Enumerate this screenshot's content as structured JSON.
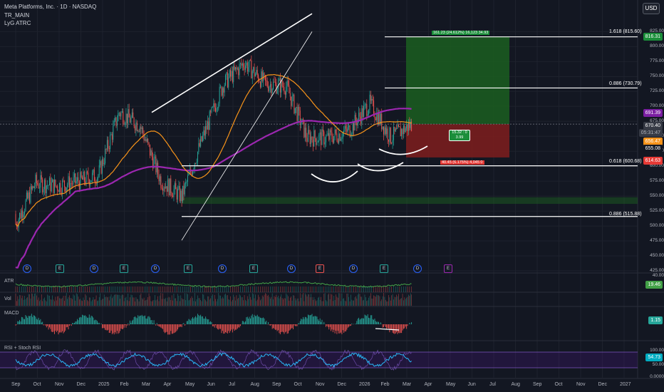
{
  "header": {
    "title": "Meta Platforms, Inc. · 1D · NASDAQ",
    "indicator1": "TR_MAIN",
    "indicator2": "LyG ATRC"
  },
  "currency_button": "USD",
  "price_axis": [
    "825.00",
    "800.00",
    "775.00",
    "750.00",
    "725.00",
    "700.00",
    "675.00",
    "650.00",
    "625.00",
    "600.00",
    "575.00",
    "550.00",
    "525.00",
    "500.00",
    "475.00",
    "450.00",
    "425.00"
  ],
  "price_badges": {
    "target": "816.31",
    "ma_purple": "691.39",
    "last_price": "670.40",
    "countdown": "05:31:47",
    "ma_orange": "656.47",
    "level_655": "655.08",
    "stop": "614.63"
  },
  "fib_labels": {
    "f1618": "1.618 (815.60)",
    "f886a": "0.886 (730.79)",
    "f618": "0.618 (600.68)",
    "f886b": "0.886 (515.88)"
  },
  "position_tool": {
    "target_text": "161.23 (24.612%) 16,123 34.93",
    "center_text1": "15.32 : 0",
    "center_text2": "3.99",
    "stop_text": "40.45 (6.175%) 4,045 0"
  },
  "time_axis": [
    "Sep",
    "Oct",
    "Nov",
    "Dec",
    "2025",
    "Feb",
    "Mar",
    "Apr",
    "May",
    "Jun",
    "Jul",
    "Aug",
    "Sep",
    "Oct",
    "Nov",
    "Dec",
    "2026",
    "Feb",
    "Mar",
    "Apr",
    "May",
    "Jun",
    "Jul",
    "Aug",
    "Sep",
    "Oct",
    "Nov",
    "Dec",
    "2027"
  ],
  "event_markers": [
    "D",
    "E",
    "D",
    "E",
    "D",
    "E",
    "D",
    "E",
    "D",
    "E",
    "D",
    "E",
    "D",
    "E"
  ],
  "panes": {
    "atr": {
      "title": "ATR",
      "value": "19.46",
      "axis_top": "40.00"
    },
    "vol": {
      "title": "Vol"
    },
    "macd": {
      "title": "MACD",
      "value": "1.15"
    },
    "rsi": {
      "title": "RSI + Stoch RSI",
      "value": "54.73",
      "axis": [
        "100.00",
        "50.00",
        "0.0000"
      ]
    }
  },
  "colors": {
    "background": "#131722",
    "up": "#26a69a",
    "down": "#ef5350",
    "ma_purple": "#9c27b0",
    "ma_orange": "#f7931a",
    "profit_zone": "#1b5e20",
    "loss_zone": "#7f1d1d"
  },
  "chart_data": {
    "type": "candlestick",
    "symbol": "Meta Platforms, Inc.",
    "timeframe": "1D",
    "exchange": "NASDAQ",
    "ylim": [
      425,
      835
    ],
    "monthly_close_approx": [
      {
        "month": "Sep 2024",
        "close": 572
      },
      {
        "month": "Oct 2024",
        "close": 567
      },
      {
        "month": "Nov 2024",
        "close": 574
      },
      {
        "month": "Dec 2024",
        "close": 585
      },
      {
        "month": "Jan 2025",
        "close": 690
      },
      {
        "month": "Feb 2025",
        "close": 668
      },
      {
        "month": "Mar 2025",
        "close": 576
      },
      {
        "month": "Apr 2025",
        "close": 549
      },
      {
        "month": "May 2025",
        "close": 647
      },
      {
        "month": "Jun 2025",
        "close": 738
      },
      {
        "month": "Jul 2025",
        "close": 773
      },
      {
        "month": "Aug 2025",
        "close": 738
      },
      {
        "month": "Sep 2025",
        "close": 734
      },
      {
        "month": "Oct 2025",
        "close": 648
      },
      {
        "month": "Nov 2025",
        "close": 647
      },
      {
        "month": "Dec 2025",
        "close": 660
      },
      {
        "month": "Jan 2026",
        "close": 705
      },
      {
        "month": "Feb 2026",
        "close": 648
      },
      {
        "month": "Mar 2026",
        "close": 670
      }
    ],
    "fib_levels": [
      {
        "ratio": "1.618",
        "price": 815.6
      },
      {
        "ratio": "0.886",
        "price": 730.79
      },
      {
        "ratio": "0.618",
        "price": 600.68
      },
      {
        "ratio": "0.886",
        "price": 515.88
      }
    ],
    "last_price": 670.4
  }
}
